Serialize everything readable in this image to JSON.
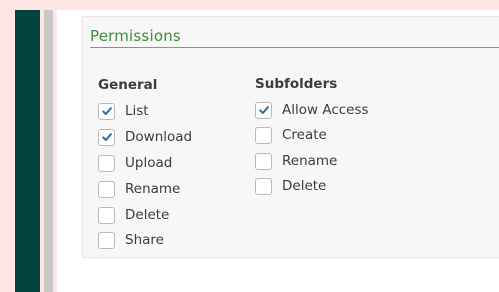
{
  "permissions": {
    "title": "Permissions",
    "general": {
      "heading": "General",
      "items": [
        {
          "label": "List",
          "checked": true
        },
        {
          "label": "Download",
          "checked": true
        },
        {
          "label": "Upload",
          "checked": false
        },
        {
          "label": "Rename",
          "checked": false
        },
        {
          "label": "Delete",
          "checked": false
        },
        {
          "label": "Share",
          "checked": false
        }
      ]
    },
    "subfolders": {
      "heading": "Subfolders",
      "items": [
        {
          "label": "Allow Access",
          "checked": true
        },
        {
          "label": "Create",
          "checked": false
        },
        {
          "label": "Rename",
          "checked": false
        },
        {
          "label": "Delete",
          "checked": false
        }
      ]
    }
  },
  "colors": {
    "accent": "#3a8d3a",
    "sidebar": "#044240",
    "check": "#2f6e9f"
  },
  "icons": {
    "checkmark": "check-icon"
  }
}
